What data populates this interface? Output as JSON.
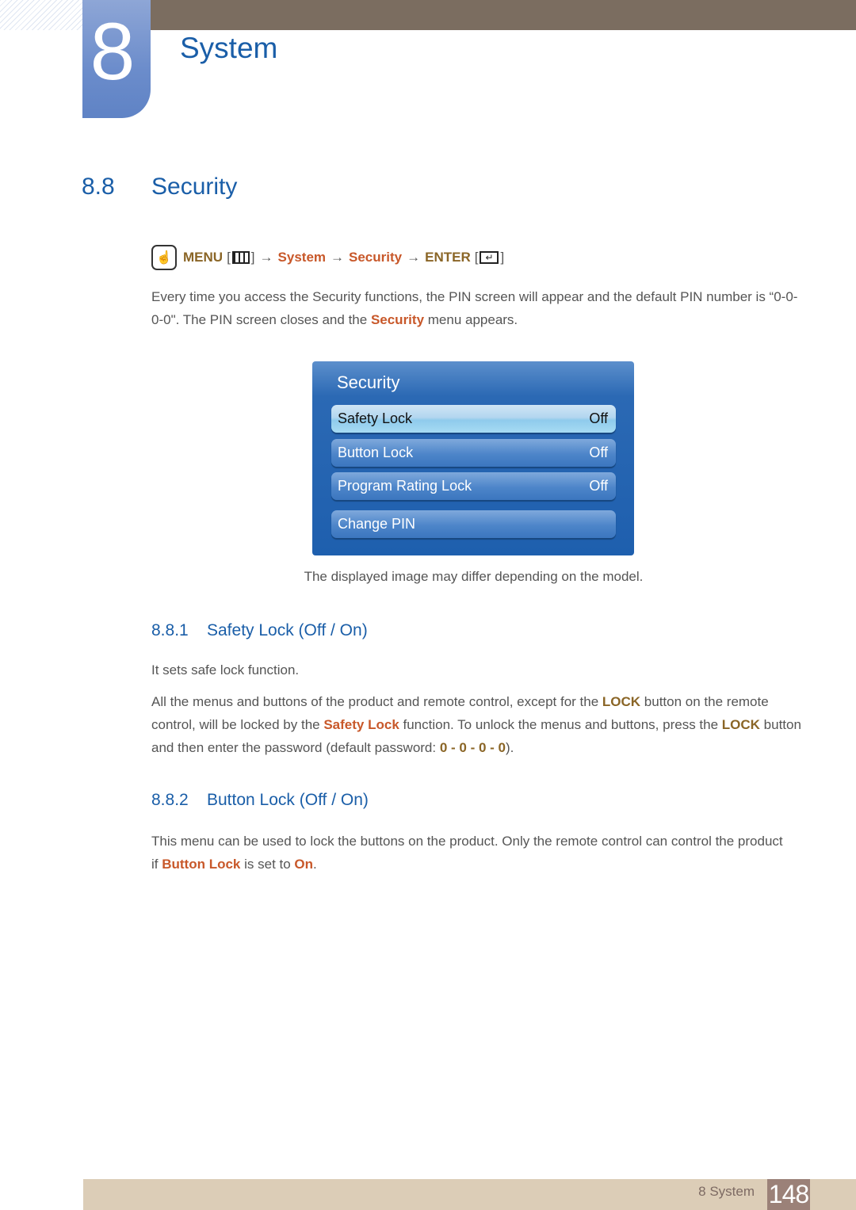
{
  "chapter": {
    "number": "8",
    "title": "System"
  },
  "section": {
    "number": "8.8",
    "title": "Security"
  },
  "nav_path": {
    "menu": "MENU",
    "brackets_open": "[",
    "brackets_close": "]",
    "arrow": "→",
    "step1": "System",
    "step2": "Security",
    "enter": "ENTER",
    "menu_icon": "menu-icon",
    "enter_icon": "enter-icon",
    "hand_icon": "hand-touch-icon"
  },
  "intro": {
    "part1": "Every time you access the Security functions, the PIN screen will appear and the default PIN number is “0-0-0-0\". The PIN screen closes and the ",
    "highlight": "Security",
    "part2": " menu appears."
  },
  "osd": {
    "title": "Security",
    "items": [
      {
        "label": "Safety Lock",
        "value": "Off",
        "selected": true
      },
      {
        "label": "Button Lock",
        "value": "Off",
        "selected": false
      },
      {
        "label": "Program Rating Lock",
        "value": "Off",
        "selected": false
      },
      {
        "label": "Change PIN",
        "value": "",
        "selected": false
      }
    ]
  },
  "caption": "The displayed image may differ depending on the model.",
  "sub1": {
    "number": "8.8.1",
    "title": "Safety Lock (Off / On)",
    "line1": "It sets safe lock function.",
    "p_a": "All the menus and buttons of the product and remote control, except for the ",
    "lock1": "LOCK",
    "p_b": " button on the remote control, will be locked by the ",
    "safety": "Safety Lock",
    "p_c": " function. To unlock the menus and buttons, press the ",
    "lock2": "LOCK",
    "p_d": " button and then enter the password (default password: ",
    "password": "0 - 0 - 0 - 0",
    "p_e": ")."
  },
  "sub2": {
    "number": "8.8.2",
    "title": "Button Lock (Off / On)",
    "p_a": "This menu can be used to lock the buttons on the product. Only the remote control can control the product if ",
    "button_lock": "Button Lock",
    "p_b": " is set to ",
    "on": "On",
    "p_c": "."
  },
  "footer": {
    "label": "8 System",
    "page": "148"
  },
  "colors": {
    "heading_blue": "#1a5ea8",
    "highlight_orange": "#c8582a",
    "highlight_gold": "#8a6526",
    "top_bar": "#7b6d60",
    "footer_bar": "#dccdb7",
    "page_box": "#9b8178"
  }
}
